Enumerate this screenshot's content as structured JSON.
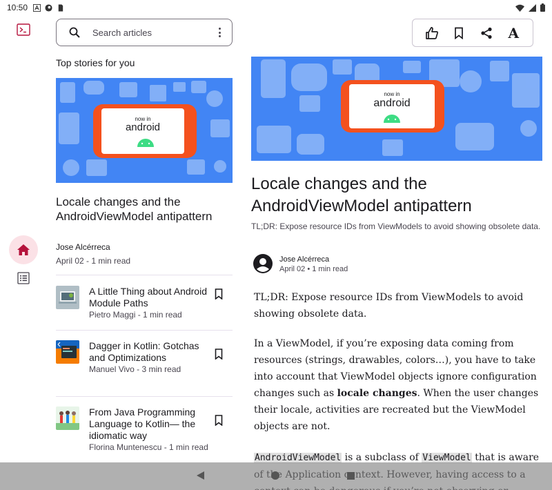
{
  "status_bar": {
    "time": "10:50",
    "icons": [
      "a-icon",
      "circle-app-icon",
      "sim-card-icon",
      "wifi-icon",
      "signal-icon",
      "battery-icon"
    ]
  },
  "nav_rail": {
    "items": [
      {
        "name": "for-you",
        "icon": "home-icon",
        "selected": true
      },
      {
        "name": "interests",
        "icon": "list-icon",
        "selected": false
      }
    ],
    "accent_color": "#b5133c",
    "selected_bg": "#fbe1e6"
  },
  "search": {
    "placeholder": "Search articles"
  },
  "feed": {
    "section_title": "Top stories for you",
    "hero": {
      "image_text_small": "now in",
      "image_text_large": "android",
      "title": "Locale changes and the AndroidViewModel antipattern",
      "author": "Jose Alcérreca",
      "meta": "April 02 - 1 min read"
    },
    "items": [
      {
        "title": "A Little Thing about Android Module Paths",
        "meta": "Pietro Maggi - 1 min read"
      },
      {
        "title": "Dagger in Kotlin: Gotchas and Optimizations",
        "meta": "Manuel Vivo - 3 min read"
      },
      {
        "title": "From Java Programming Language to Kotlin— the idiomatic way",
        "meta": "Florina Muntenescu - 1 min read"
      }
    ]
  },
  "action_bar": {
    "icons": [
      "thumb-up-icon",
      "bookmark-icon",
      "share-icon",
      "text-format-icon"
    ],
    "font_label": "A"
  },
  "detail": {
    "image_text_small": "now in",
    "image_text_large": "android",
    "title": "Locale changes and the AndroidViewModel antipattern",
    "subtitle": "TL;DR: Expose resource IDs from ViewModels to avoid showing obsolete data.",
    "author": "Jose Alcérreca",
    "meta": "April 02 • 1 min read",
    "p1": "TL;DR: Expose resource IDs from ViewModels to avoid showing obsolete data.",
    "p2_a": "In a ViewModel, if you’re exposing data coming from resources (strings, drawables, colors…), you have to take into account that ViewModel objects ignore configuration changes such as ",
    "p2_bold": "locale changes",
    "p2_b": ". When the user changes their locale, activities are recreated but the ViewModel objects are not.",
    "p3_code1": "AndroidViewModel",
    "p3_a": " is a subclass of ",
    "p3_code2": "ViewModel",
    "p3_b": " that is aware of the Application context. However, having access to a context can be dangerous if you’re not observing or"
  }
}
